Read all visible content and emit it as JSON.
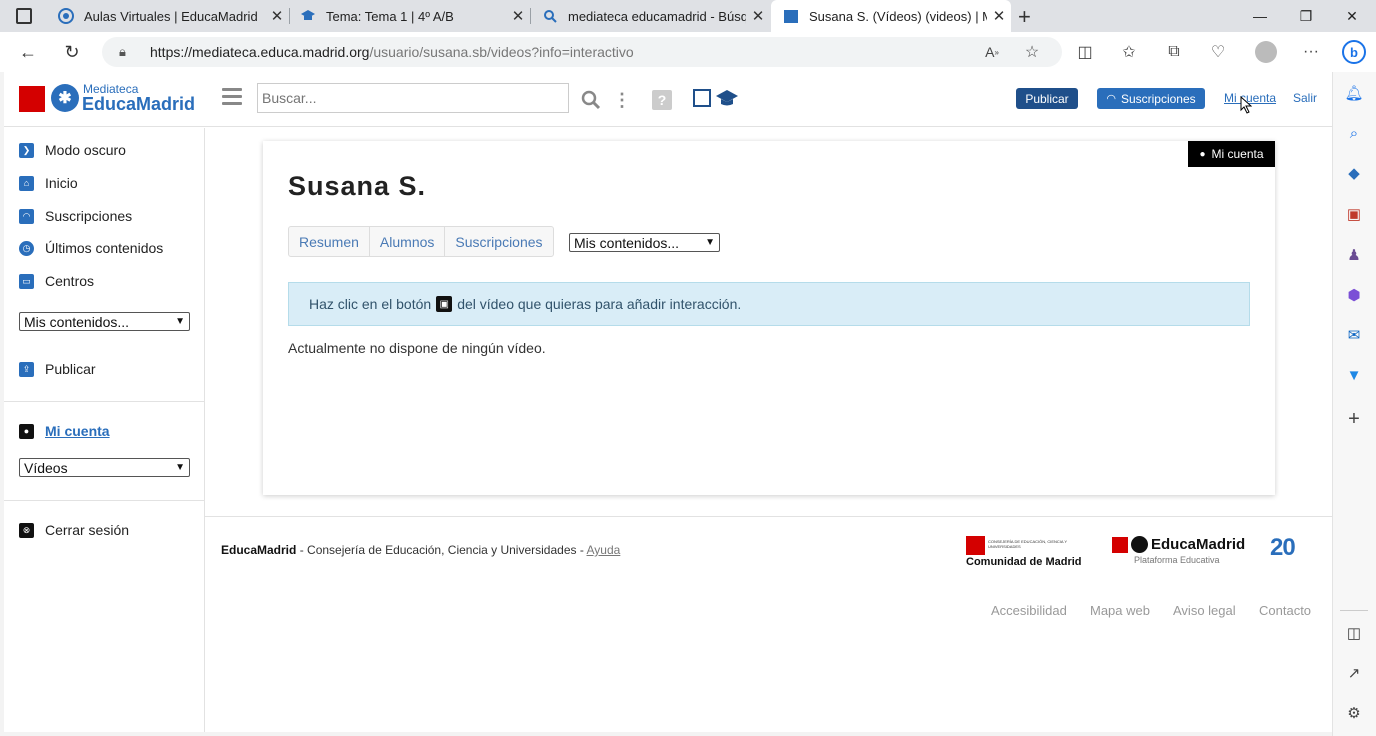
{
  "browser": {
    "tabs": [
      {
        "title": "Aulas Virtuales | EducaMadrid",
        "icon": "educamadrid-icon"
      },
      {
        "title": "Tema: Tema 1 | 4º A/B",
        "icon": "mortarboard-icon"
      },
      {
        "title": "mediateca educamadrid - Búsqu",
        "icon": "search-icon"
      },
      {
        "title": "Susana S. (Vídeos) (videos) | Med",
        "icon": "clapperboard-icon"
      }
    ],
    "url_host": "https://mediateca.educa.madrid.org",
    "url_path": "/usuario/susana.sb/videos?info=interactivo"
  },
  "header": {
    "logo_small": "Mediateca",
    "logo_big": "EducaMadrid",
    "search_placeholder": "Buscar...",
    "publish_label": "Publicar",
    "subscriptions_label": "Suscripciones",
    "account_label": "Mi cuenta",
    "exit_label": "Salir"
  },
  "sidebar": {
    "items": [
      {
        "label": "Modo oscuro",
        "color": "#2a6ebb"
      },
      {
        "label": "Inicio",
        "color": "#2a6ebb"
      },
      {
        "label": "Suscripciones",
        "color": "#2a6ebb"
      },
      {
        "label": "Últimos contenidos",
        "color": "#2a6ebb"
      },
      {
        "label": "Centros",
        "color": "#2a6ebb"
      }
    ],
    "select1_value": "Mis contenidos...",
    "publish_label": "Publicar",
    "account_label": "Mi cuenta",
    "select2_value": "Vídeos",
    "logout_label": "Cerrar sesión"
  },
  "main": {
    "badge_label": "Mi cuenta",
    "title": "Susana S.",
    "tabs": [
      "Resumen",
      "Alumnos",
      "Suscripciones"
    ],
    "select_value": "Mis contenidos...",
    "info_before": "Haz clic en el botón",
    "info_after": "del vídeo que quieras para añadir interacción.",
    "empty_text": "Actualmente no dispone de ningún vídeo."
  },
  "footer": {
    "brand": "EducaMadrid",
    "text": " - Consejería de Educación, Ciencia y Universidades - ",
    "help": "Ayuda",
    "comunidad_small": "CONSEJERÍA DE EDUCACIÓN, CIENCIA Y UNIVERSIDADES",
    "comunidad_big": "Comunidad de Madrid",
    "educa_logo": "EducaMadrid",
    "educa_sub": "Plataforma Educativa",
    "anniv": "20",
    "links": [
      "Accesibilidad",
      "Mapa web",
      "Aviso legal",
      "Contacto"
    ]
  },
  "colors": {
    "accent": "#2a6ebb",
    "dark_blue": "#1f4f8a",
    "info_bg": "#d9edf7",
    "brand_red": "#d40000"
  }
}
